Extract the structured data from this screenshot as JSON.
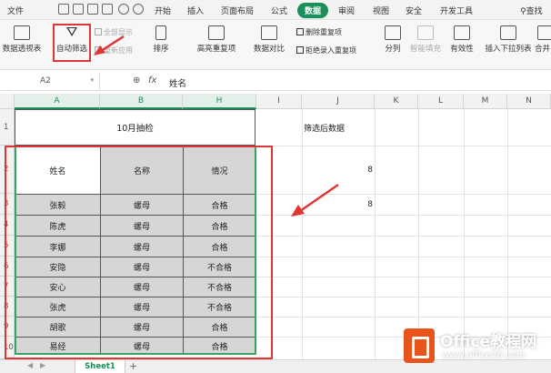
{
  "menubar": {
    "file": "文件",
    "tabs": [
      "开始",
      "插入",
      "页面布局",
      "公式",
      "数据",
      "审阅",
      "视图",
      "安全",
      "开发工具"
    ],
    "active_tab": "数据",
    "search": "查找"
  },
  "ribbon": {
    "pivot": "数据透视表",
    "autofilter": "自动筛选",
    "show_all": "全部显示",
    "reapply": "重新应用",
    "sort": "排序",
    "highlight_dup": "高亮重复项",
    "compare": "数据对比",
    "remove_dup": "删除重复项",
    "reject_dup": "拒绝录入重复项",
    "split": "分列",
    "smart_fill": "智能填充",
    "validity": "有效性",
    "insert_dropdown": "插入下拉列表",
    "merge": "合并"
  },
  "formula_bar": {
    "name_box": "A2",
    "value": "姓名"
  },
  "columns": [
    "A",
    "B",
    "H",
    "I",
    "J",
    "K",
    "L",
    "M",
    "N"
  ],
  "rows": [
    "1",
    "2",
    "3",
    "4",
    "5",
    "6",
    "7",
    "8",
    "9",
    "10"
  ],
  "title": "10月抽检",
  "side_label": "筛选后数据",
  "side_values": [
    "8",
    "8"
  ],
  "table": {
    "headers": [
      "姓名",
      "名称",
      "情况"
    ],
    "rows": [
      [
        "张毅",
        "螺母",
        "合格"
      ],
      [
        "陈虎",
        "螺母",
        "合格"
      ],
      [
        "李娜",
        "螺母",
        "合格"
      ],
      [
        "安隐",
        "螺母",
        "不合格"
      ],
      [
        "安心",
        "螺母",
        "不合格"
      ],
      [
        "张虎",
        "螺母",
        "不合格"
      ],
      [
        "胡歌",
        "螺母",
        "合格"
      ],
      [
        "易经",
        "螺母",
        "合格"
      ]
    ]
  },
  "sheet_tab": "Sheet1",
  "watermark": {
    "brand": "Office教程网",
    "url": "www.office26.com"
  },
  "colors": {
    "accent": "#1b8f5b",
    "annotation": "#e03535",
    "header_fill": "#d6d6d6"
  }
}
